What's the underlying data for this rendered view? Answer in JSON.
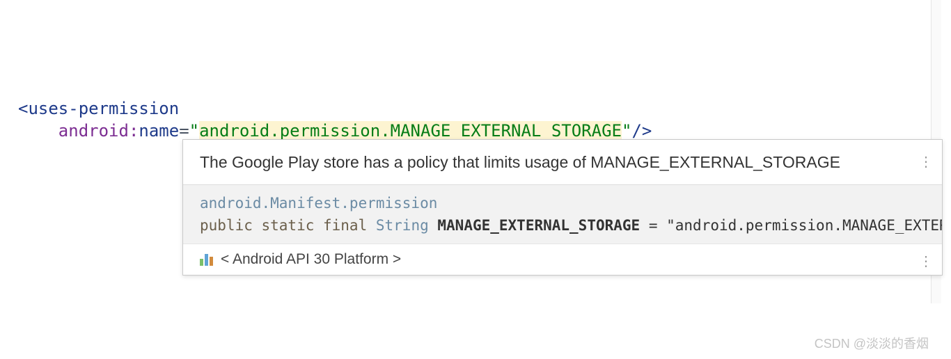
{
  "code": {
    "tagOpen": "<",
    "tagName": "uses-permission",
    "attrNs": "android",
    "attrColon": ":",
    "attrName": "name",
    "eq": "=",
    "q": "\"",
    "value": "android.permission.MANAGE_EXTERNAL_STORAGE",
    "close": "/>"
  },
  "popup": {
    "warning": "The Google Play store has a policy that limits usage of MANAGE_EXTERNAL_STORAGE",
    "docClass": "android.Manifest.permission",
    "docModifiers": "public static final",
    "docType": "String",
    "docConst": "MANAGE_EXTERNAL_STORAGE",
    "docEq": " = ",
    "docValue": "\"android.permission.MANAGE_EXTERNAL_ST",
    "source": "< Android API 30 Platform >",
    "menu": "⋮"
  },
  "watermark": "CSDN @淡淡的香烟"
}
